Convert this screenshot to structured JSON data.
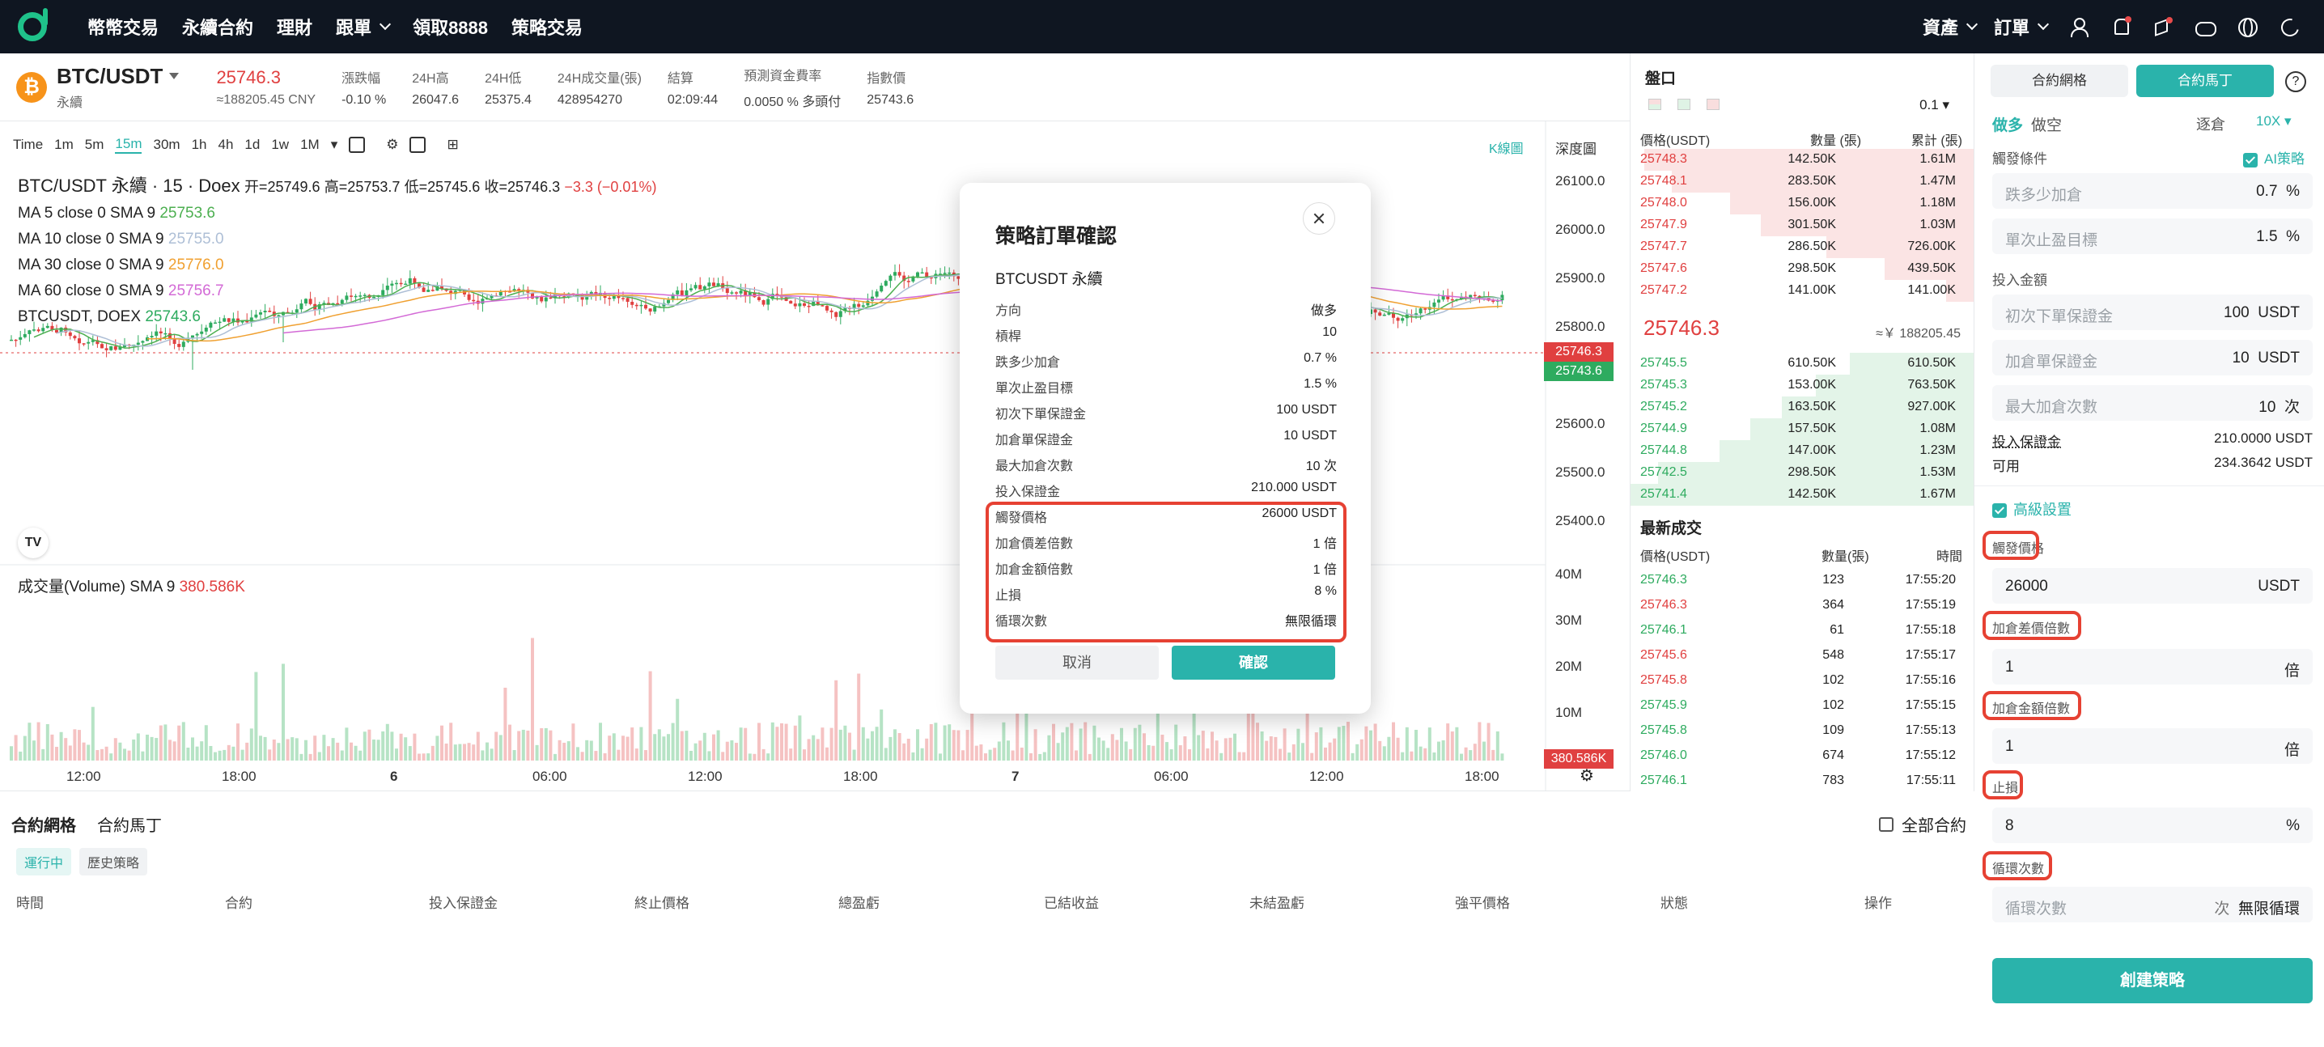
{
  "topbar": {
    "nav": [
      "幣幣交易",
      "永續合約",
      "理財",
      "跟單",
      "領取8888",
      "策略交易"
    ],
    "right": {
      "assets": "資產",
      "orders": "訂單"
    }
  },
  "ticker": {
    "coin": "₿",
    "pair": "BTC/USDT",
    "type": "永續",
    "last": "25746.3",
    "cny": "≈188205.45 CNY",
    "stats": [
      {
        "label": "漲跌幅",
        "value": "-0.10 %"
      },
      {
        "label": "24H高",
        "value": "26047.6"
      },
      {
        "label": "24H低",
        "value": "25375.4"
      },
      {
        "label": "24H成交量(張)",
        "value": "428954270"
      },
      {
        "label": "結算",
        "value": "02:09:44"
      },
      {
        "label": "預測資金費率",
        "value": "0.0050 % 多頭付"
      },
      {
        "label": "指數價",
        "value": "25743.6"
      }
    ]
  },
  "chart": {
    "timeframes": [
      "Time",
      "1m",
      "5m",
      "15m",
      "30m",
      "1h",
      "4h",
      "1d",
      "1w",
      "1M"
    ],
    "active_tf": "15m",
    "kline_tab": "K線圖",
    "depth_tab": "深度圖",
    "legend": {
      "title": "BTC/USDT 永續 · 15 · Doex",
      "ohlc_open": "开=25749.6",
      "ohlc_high": "高=25753.7",
      "ohlc_low": "低=25745.6",
      "ohlc_close": "收=25746.3",
      "ohlc_change": "−3.3 (−0.01%)",
      "ma": [
        {
          "label": "MA 5 close 0 SMA 9",
          "value": "25753.6",
          "color": "#4caf50"
        },
        {
          "label": "MA 10 close 0 SMA 9",
          "value": "25755.0",
          "color": "#aebfd6"
        },
        {
          "label": "MA 30 close 0 SMA 9",
          "value": "25776.0",
          "color": "#f0a030"
        },
        {
          "label": "MA 60 close 0 SMA 9",
          "value": "25756.7",
          "color": "#d36ad6"
        },
        {
          "label": "BTCUSDT, DOEX",
          "value": "25743.6",
          "color": "#2eab5f"
        }
      ]
    },
    "price_axis": [
      "26100.0",
      "26000.0",
      "25900.0",
      "25800.0",
      "25600.0",
      "25500.0",
      "25400.0"
    ],
    "price_tag_red": "25746.3",
    "price_tag_green": "25743.6",
    "vol_label": "成交量(Volume) SMA 9",
    "vol_value": "380.586K",
    "vol_axis": [
      "40M",
      "30M",
      "20M",
      "10M"
    ],
    "vol_tag": "380.586K",
    "x_axis": [
      "12:00",
      "18:00",
      "6",
      "06:00",
      "12:00",
      "18:00",
      "7",
      "06:00",
      "12:00",
      "18:00"
    ]
  },
  "orderbook": {
    "title": "盤口",
    "precision": "0.1",
    "cols": [
      "價格(USDT)",
      "數量 (張)",
      "累計 (張)"
    ],
    "asks": [
      [
        "25748.3",
        "142.50K",
        "1.61M"
      ],
      [
        "25748.1",
        "283.50K",
        "1.47M"
      ],
      [
        "25748.0",
        "156.00K",
        "1.18M"
      ],
      [
        "25747.9",
        "301.50K",
        "1.03M"
      ],
      [
        "25747.7",
        "286.50K",
        "726.00K"
      ],
      [
        "25747.6",
        "298.50K",
        "439.50K"
      ],
      [
        "25747.2",
        "141.00K",
        "141.00K"
      ]
    ],
    "mid": "25746.3",
    "mid_cny": "≈￥ 188205.45",
    "bids": [
      [
        "25745.5",
        "610.50K",
        "610.50K"
      ],
      [
        "25745.3",
        "153.00K",
        "763.50K"
      ],
      [
        "25745.2",
        "163.50K",
        "927.00K"
      ],
      [
        "25744.9",
        "157.50K",
        "1.08M"
      ],
      [
        "25744.8",
        "147.00K",
        "1.23M"
      ],
      [
        "25742.5",
        "298.50K",
        "1.53M"
      ],
      [
        "25741.4",
        "142.50K",
        "1.67M"
      ]
    ],
    "ask_depth": [
      0.96,
      0.88,
      0.71,
      0.62,
      0.43,
      0.26,
      0.08
    ],
    "bid_depth": [
      0.36,
      0.46,
      0.56,
      0.65,
      0.74,
      0.92,
      1.0
    ]
  },
  "trades": {
    "title": "最新成交",
    "cols": [
      "價格(USDT)",
      "數量(張)",
      "時間"
    ],
    "rows": [
      [
        "25746.3",
        "123",
        "17:55:20",
        "g"
      ],
      [
        "25746.3",
        "364",
        "17:55:19",
        "r"
      ],
      [
        "25746.1",
        "61",
        "17:55:18",
        "g"
      ],
      [
        "25745.6",
        "548",
        "17:55:17",
        "r"
      ],
      [
        "25745.8",
        "102",
        "17:55:16",
        "r"
      ],
      [
        "25745.9",
        "102",
        "17:55:15",
        "g"
      ],
      [
        "25745.8",
        "109",
        "17:55:13",
        "g"
      ],
      [
        "25746.0",
        "674",
        "17:55:12",
        "g"
      ],
      [
        "25746.1",
        "783",
        "17:55:11",
        "g"
      ]
    ]
  },
  "bottom": {
    "tabs": [
      "合約網格",
      "合約馬丁"
    ],
    "chips": [
      "運行中",
      "歷史策略"
    ],
    "all_contracts": "全部合約",
    "headers": [
      "時間",
      "合約",
      "投入保證金",
      "終止價格",
      "總盈虧",
      "已結收益",
      "未結盈虧",
      "強平價格",
      "狀態",
      "操作"
    ]
  },
  "right": {
    "seg": [
      "合約網格",
      "合約馬丁"
    ],
    "help": "?",
    "long": "做多",
    "short": "做空",
    "mode": "逐倉",
    "lev": "10X",
    "trigger_cond": "觸發條件",
    "ai": "AI策略",
    "fall_ph": "跌多少加倉",
    "fall_val": "0.7",
    "fall_unit": "%",
    "tp_ph": "單次止盈目標",
    "tp_val": "1.5",
    "tp_unit": "%",
    "invest_label": "投入金額",
    "init_ph": "初次下單保證金",
    "init_val": "100",
    "init_unit": "USDT",
    "add_ph": "加倉單保證金",
    "add_val": "10",
    "add_unit": "USDT",
    "max_ph": "最大加倉次數",
    "max_val": "10",
    "max_unit": "次",
    "margin_label": "投入保證金",
    "margin_val": "210.0000 USDT",
    "avail_label": "可用",
    "avail_val": "234.3642 USDT",
    "advanced": "高級設置",
    "trig_price_label": "觸發價格",
    "trig_price_val": "26000",
    "trig_price_unit": "USDT",
    "gap_label": "加倉差價倍數",
    "gap_val": "1",
    "gap_unit": "倍",
    "amt_label": "加倉金額倍數",
    "amt_val": "1",
    "amt_unit": "倍",
    "sl_label": "止損",
    "sl_val": "8",
    "sl_unit": "%",
    "loop_label": "循環次數",
    "loop_ph": "循環次數",
    "loop_unit": "次",
    "loop_val": "無限循環",
    "create": "創建策略"
  },
  "modal": {
    "title": "策略訂單確認",
    "subtitle": "BTCUSDT 永續",
    "rows": [
      [
        "方向",
        "做多"
      ],
      [
        "槓桿",
        "10"
      ],
      [
        "跌多少加倉",
        "0.7 %"
      ],
      [
        "單次止盈目標",
        "1.5 %"
      ],
      [
        "初次下單保證金",
        "100 USDT"
      ],
      [
        "加倉單保證金",
        "10 USDT"
      ],
      [
        "最大加倉次數",
        "10 次"
      ],
      [
        "投入保證金",
        "210.000 USDT"
      ],
      [
        "觸發價格",
        "26000 USDT"
      ],
      [
        "加倉價差倍數",
        "1 倍"
      ],
      [
        "加倉金額倍數",
        "1 倍"
      ],
      [
        "止損",
        "8 %"
      ],
      [
        "循環次數",
        "無限循環"
      ]
    ],
    "cancel": "取消",
    "confirm": "確認"
  },
  "colors": {
    "accent": "#2ab3ab",
    "up": "#2eab5f",
    "down": "#e04040",
    "highlight": "#e64133"
  }
}
